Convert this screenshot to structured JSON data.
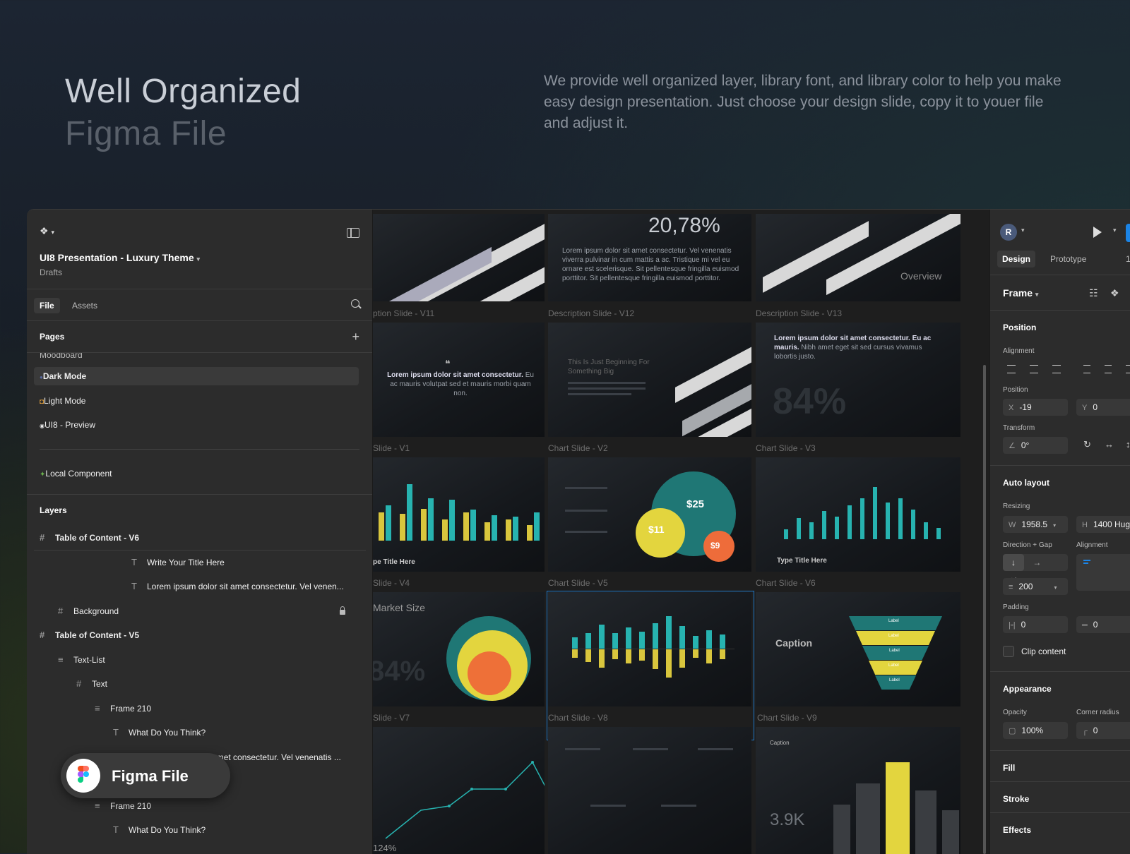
{
  "hero": {
    "title_line1": "Well Organized",
    "title_line2": "Figma File",
    "description": "We provide well organized layer, library font, and library color to help you make easy design presentation. Just choose your design slide, copy it to youer file and adjust it."
  },
  "left_panel": {
    "file_title": "UI8 Presentation - Luxury Theme",
    "file_location": "Drafts",
    "tabs": [
      "File",
      "Assets"
    ],
    "pages_label": "Pages",
    "pages": [
      {
        "label": "Moodboard"
      },
      {
        "label": "Dark Mode",
        "selected": true
      },
      {
        "label": "Light Mode"
      },
      {
        "label": "UI8 - Preview"
      },
      {
        "label": "Local Component"
      }
    ],
    "layers_label": "Layers",
    "layers": [
      {
        "label": "Table of Content - V6",
        "icon": "frame-icon",
        "indent": 0,
        "bold": true
      },
      {
        "label": "Write Your Title Here",
        "icon": "text-icon",
        "indent": 4,
        "bold": false
      },
      {
        "label": "Lorem ipsum dolor sit amet consectetur. Vel venen...",
        "icon": "text-icon",
        "indent": 4,
        "bold": false
      },
      {
        "label": "Background",
        "icon": "frame-icon",
        "indent": 1,
        "bold": false,
        "locked": true
      },
      {
        "label": "Table of Content - V5",
        "icon": "frame-icon",
        "indent": 0,
        "bold": true
      },
      {
        "label": "Text-List",
        "icon": "autolayout-icon",
        "indent": 1,
        "bold": false
      },
      {
        "label": "Text",
        "icon": "frame-icon",
        "indent": 2,
        "bold": false
      },
      {
        "label": "Frame 210",
        "icon": "autolayout-icon",
        "indent": 3,
        "bold": false
      },
      {
        "label": "What Do You Think?",
        "icon": "text-icon",
        "indent": 4,
        "bold": false
      },
      {
        "label": "Lorem ipsum dolor sit amet consectetur. Vel venenatis ...",
        "icon": "text-icon",
        "indent": 4,
        "bold": false
      },
      {
        "label": "Frame 210",
        "icon": "autolayout-icon",
        "indent": 3,
        "bold": false
      },
      {
        "label": "What Do You Think?",
        "icon": "text-icon",
        "indent": 4,
        "bold": false
      }
    ],
    "badge": "Figma File"
  },
  "canvas": {
    "slides": [
      {
        "label": "",
        "big": "",
        "text": ""
      },
      {
        "label": "",
        "big": "20,78%",
        "text": "Lorem ipsum dolor sit amet consectetur. Vel venenatis viverra pulvinar in cum mattis a ac. Tristique mi vel eu ornare est scelerisque. Sit pellentesque fringilla euismod porttitor. Sit pellentesque fringilla euismod porttitor."
      },
      {
        "label": "",
        "big": "Overview",
        "text": ""
      },
      {
        "label": "ption Slide - V11",
        "big": "",
        "text_bold": "Lorem ipsum dolor sit amet consectetur.",
        "text": "Eu ac mauris volutpat sed et mauris morbi quam non."
      },
      {
        "label": "Description Slide - V12",
        "big": "This Is Just Beginning For Something Big",
        "text": ""
      },
      {
        "label": "Description Slide - V13",
        "big": "84%",
        "text_bold": "Lorem ipsum dolor sit amet consectetur. Eu ac mauris.",
        "text": "Nibh amet eget sit sed cursus vivamus lobortis justo."
      },
      {
        "label": "Slide - V1",
        "big": "",
        "text": "pe Title Here"
      },
      {
        "label": "Chart Slide - V2",
        "big": "",
        "text": ""
      },
      {
        "label": "Chart Slide - V3",
        "big": "Type Title Here",
        "text": ""
      },
      {
        "label": "Slide - V4",
        "big": "84%",
        "text": "Market Size"
      },
      {
        "label": "Chart Slide - V5",
        "big": "",
        "text": ""
      },
      {
        "label": "Chart Slide - V6",
        "big": "Caption",
        "text": ""
      },
      {
        "label": "Slide - V7",
        "big": "124%",
        "text": ""
      },
      {
        "label": "Chart Slide - V8",
        "big": "",
        "text": ""
      },
      {
        "label": "Chart Slide - V9",
        "big": "3.9K",
        "text": "Caption"
      }
    ],
    "bubble_values": [
      "$25",
      "$11",
      "$9"
    ],
    "funnel_labels": [
      "Label",
      "Label",
      "Label",
      "Label",
      "Label"
    ]
  },
  "right_panel": {
    "avatar_letter": "R",
    "tabs": [
      "Design",
      "Prototype"
    ],
    "zoom": "1",
    "frame_label": "Frame",
    "position_label": "Position",
    "alignment_label": "Alignment",
    "position_sub": "Position",
    "x_value": "-19",
    "y_value": "0",
    "transform_label": "Transform",
    "rotation": "0°",
    "auto_layout_label": "Auto layout",
    "resizing_label": "Resizing",
    "width": "1958.5",
    "height": "1400",
    "hug": "Hug",
    "direction_gap_label": "Direction + Gap",
    "alignment2_label": "Alignment",
    "gap": "200",
    "padding_label": "Padding",
    "padding_h": "0",
    "padding_v": "0",
    "clip_content": "Clip content",
    "appearance_label": "Appearance",
    "opacity_label": "Opacity",
    "opacity": "100%",
    "corner_label": "Corner radius",
    "corner": "0",
    "fill": "Fill",
    "stroke": "Stroke",
    "effects": "Effects"
  }
}
